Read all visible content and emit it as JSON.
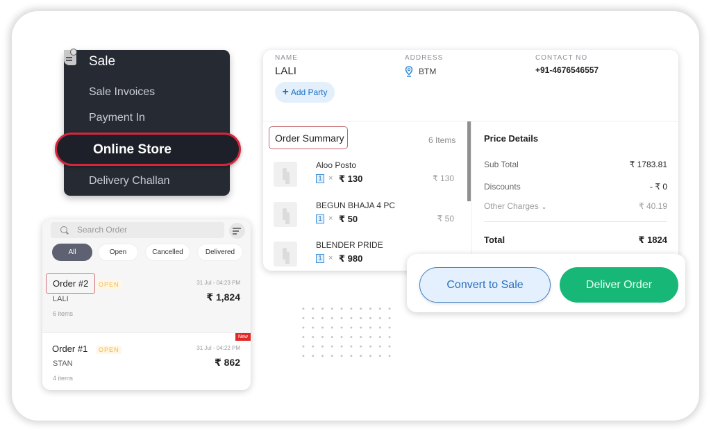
{
  "sale_menu": {
    "title": "Sale",
    "items": [
      {
        "label": "Sale Invoices"
      },
      {
        "label": "Payment In"
      },
      {
        "label": "Online Store",
        "highlighted": true
      },
      {
        "label": "Delivery Challan"
      }
    ],
    "icon": "sale-document-icon"
  },
  "party": {
    "name_label": "NAME",
    "name": "LALI",
    "address_label": "ADDRESS",
    "address": "BTM",
    "contact_label": "CONTACT NO",
    "contact": "+91-4676546557",
    "add_party_plus": "+",
    "add_party_label": "Add Party"
  },
  "order_summary": {
    "title": "Order Summary",
    "count": "6 Items",
    "items": [
      {
        "name": "Aloo Posto",
        "qty": "1",
        "times": "×",
        "unit_price": "₹ 130",
        "total": "₹ 130"
      },
      {
        "name": "BEGUN BHAJA 4 PC",
        "qty": "1",
        "times": "×",
        "unit_price": "₹ 50",
        "total": "₹ 50"
      },
      {
        "name": "BLENDER PRIDE",
        "qty": "1",
        "times": "×",
        "unit_price": "₹ 980",
        "total": ""
      }
    ]
  },
  "price_details": {
    "title": "Price Details",
    "rows": [
      {
        "label": "Sub Total",
        "value": "₹ 1783.81"
      },
      {
        "label": "Discounts",
        "value": "- ₹ 0"
      },
      {
        "label": "Other Charges",
        "value": "₹ 40.19",
        "chevron": "⌄"
      }
    ],
    "total_label": "Total",
    "total_value": "₹ 1824"
  },
  "actions": {
    "convert_label": "Convert to Sale",
    "deliver_label": "Deliver Order",
    "convert_color": "#e4f0fd",
    "deliver_color": "#17b877"
  },
  "order_list": {
    "search_placeholder": "Search Order",
    "filters": [
      {
        "label": "All",
        "active": true
      },
      {
        "label": "Open"
      },
      {
        "label": "Cancelled"
      },
      {
        "label": "Delivered"
      }
    ],
    "orders": [
      {
        "id": "Order #2",
        "status": "OPEN",
        "time": "31 Jul - 04:23 PM",
        "party": "LALI",
        "amount": "₹ 1,824",
        "items": "6 items"
      },
      {
        "id": "Order #1",
        "status": "OPEN",
        "time": "31 Jul - 04:22 PM",
        "party": "STAN",
        "amount": "₹ 862",
        "items": "4 items",
        "badge": "New"
      }
    ]
  },
  "colors": {
    "highlight_red": "#d9253c",
    "menu_bg": "#262a33",
    "accent_blue": "#1a6fc4",
    "open_badge": "#f2b64c"
  }
}
